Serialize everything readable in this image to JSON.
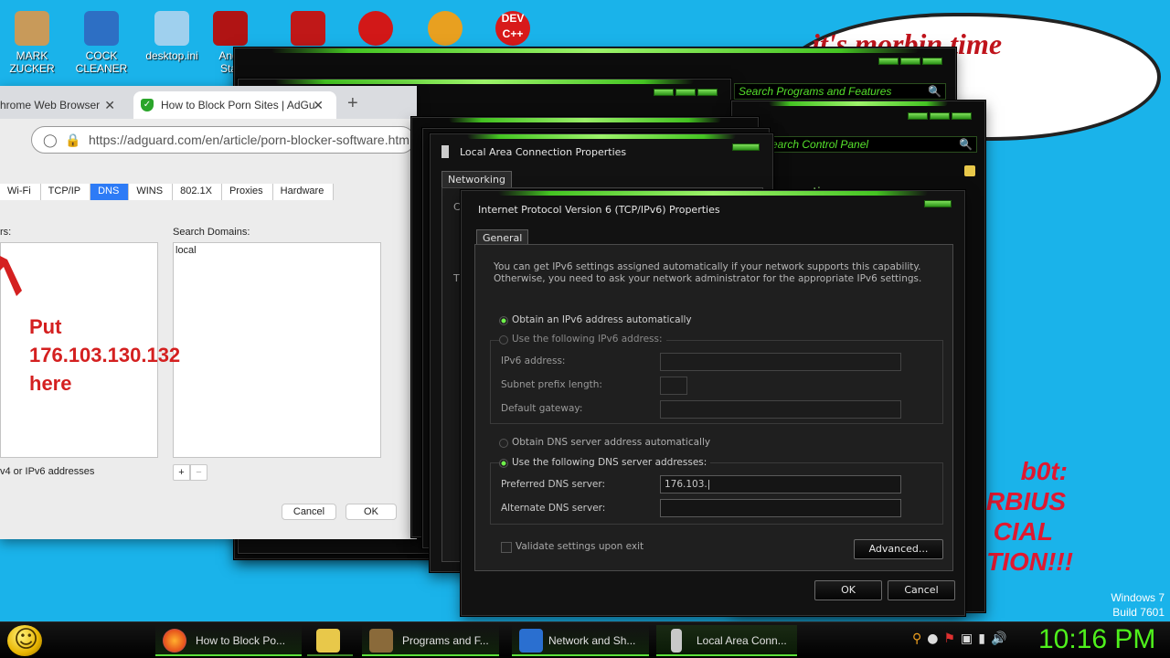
{
  "desktop": {
    "icons": [
      {
        "label": "MARK\nZUCKER",
        "color": "#d3a86a"
      },
      {
        "label": "COCK\nCLEANER",
        "color": "#2d6fc4"
      },
      {
        "label": "desktop.ini",
        "color": "#9fd0ee"
      },
      {
        "label": "Angr\nStar",
        "color": "#c01818"
      },
      {
        "label": "",
        "color": "#c01818"
      },
      {
        "label": "",
        "color": "#d21818"
      },
      {
        "label": "",
        "color": "#e8a020"
      },
      {
        "label": "DEV\nC++",
        "color": "#d81a1a"
      }
    ],
    "bubble_text": "it's morbin  time",
    "side_text": [
      "b0t:",
      "RBIUS",
      "CIAL",
      "TION!!!"
    ],
    "watermark": {
      "line1": "Windows 7",
      "line2": "Build 7601"
    }
  },
  "explorer_windows": {
    "search_programs": "Search Programs and Features",
    "search_control": "earch Control Panel",
    "partial_text": "onnections"
  },
  "browser": {
    "tab_inactive": "hrome Web Browser",
    "tab_active": "How to Block Porn Sites | AdGu",
    "url": "https://adguard.com/en/article/porn-blocker-software.htm"
  },
  "mac_prefs": {
    "tabs": [
      "Wi-Fi",
      "TCP/IP",
      "DNS",
      "WINS",
      "802.1X",
      "Proxies",
      "Hardware"
    ],
    "selected_tab": "DNS",
    "dns_servers_label": "rs:",
    "search_domains_label": "Search Domains:",
    "search_domain_value": "local",
    "annotation": [
      "Put",
      "176.103.130.132",
      "here"
    ],
    "footer_note": "v4 or IPv6 addresses",
    "add_btn": "+",
    "remove_btn": "−",
    "cancel": "Cancel",
    "ok": "OK"
  },
  "lac_dialog": {
    "title": "Local Area Connection Properties",
    "tab": "Networking",
    "partial1": "C",
    "partial2": "T"
  },
  "ipv6_dialog": {
    "title": "Internet Protocol Version 6 (TCP/IPv6) Properties",
    "tab": "General",
    "description": "You can get IPv6 settings assigned automatically if your network supports this capability. Otherwise, you need to ask your network administrator for the appropriate IPv6 settings.",
    "radio_auto_ip": "Obtain an IPv6 address automatically",
    "radio_manual_ip": "Use the following IPv6 address:",
    "ipv6_address_label": "IPv6 address:",
    "subnet_label": "Subnet prefix length:",
    "gateway_label": "Default gateway:",
    "radio_auto_dns": "Obtain DNS server address automatically",
    "radio_manual_dns": "Use the following DNS server addresses:",
    "preferred_dns_label": "Preferred DNS server:",
    "preferred_dns_value": "176.103.|",
    "alternate_dns_label": "Alternate DNS server:",
    "validate_label": "Validate settings upon exit",
    "advanced": "Advanced...",
    "ok": "OK",
    "cancel": "Cancel"
  },
  "taskbar": {
    "tasks": [
      {
        "label": "How to Block Po...",
        "color": "#e8571c"
      },
      {
        "label": "",
        "color": "#e8c84a"
      },
      {
        "label": "Programs and F...",
        "color": "#8a6a3a"
      },
      {
        "label": "Network and Sh...",
        "color": "#2a6fd0"
      },
      {
        "label": "Local Area Conn...",
        "color": "#c8c8c8"
      }
    ],
    "clock": "10:16 PM",
    "accent": "#4ff01c"
  }
}
